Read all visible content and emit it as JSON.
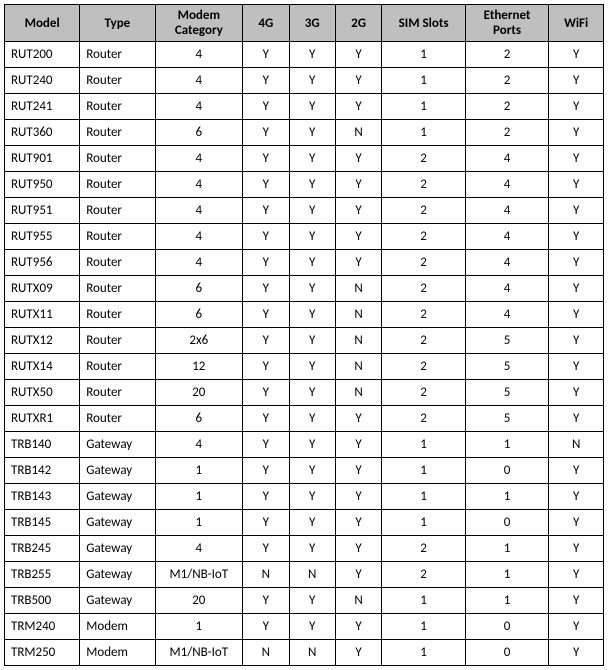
{
  "chart_data": {
    "type": "table",
    "columns": [
      "Model",
      "Type",
      "Modem Category",
      "4G",
      "3G",
      "2G",
      "SIM Slots",
      "Ethernet Ports",
      "WiFi"
    ],
    "rows": [
      [
        "RUT200",
        "Router",
        "4",
        "Y",
        "Y",
        "Y",
        "1",
        "2",
        "Y"
      ],
      [
        "RUT240",
        "Router",
        "4",
        "Y",
        "Y",
        "Y",
        "1",
        "2",
        "Y"
      ],
      [
        "RUT241",
        "Router",
        "4",
        "Y",
        "Y",
        "Y",
        "1",
        "2",
        "Y"
      ],
      [
        "RUT360",
        "Router",
        "6",
        "Y",
        "Y",
        "N",
        "1",
        "2",
        "Y"
      ],
      [
        "RUT901",
        "Router",
        "4",
        "Y",
        "Y",
        "Y",
        "2",
        "4",
        "Y"
      ],
      [
        "RUT950",
        "Router",
        "4",
        "Y",
        "Y",
        "Y",
        "2",
        "4",
        "Y"
      ],
      [
        "RUT951",
        "Router",
        "4",
        "Y",
        "Y",
        "Y",
        "2",
        "4",
        "Y"
      ],
      [
        "RUT955",
        "Router",
        "4",
        "Y",
        "Y",
        "Y",
        "2",
        "4",
        "Y"
      ],
      [
        "RUT956",
        "Router",
        "4",
        "Y",
        "Y",
        "Y",
        "2",
        "4",
        "Y"
      ],
      [
        "RUTX09",
        "Router",
        "6",
        "Y",
        "Y",
        "N",
        "2",
        "4",
        "Y"
      ],
      [
        "RUTX11",
        "Router",
        "6",
        "Y",
        "Y",
        "N",
        "2",
        "4",
        "Y"
      ],
      [
        "RUTX12",
        "Router",
        "2x6",
        "Y",
        "Y",
        "N",
        "2",
        "5",
        "Y"
      ],
      [
        "RUTX14",
        "Router",
        "12",
        "Y",
        "Y",
        "N",
        "2",
        "5",
        "Y"
      ],
      [
        "RUTX50",
        "Router",
        "20",
        "Y",
        "Y",
        "N",
        "2",
        "5",
        "Y"
      ],
      [
        "RUTXR1",
        "Router",
        "6",
        "Y",
        "Y",
        "Y",
        "2",
        "5",
        "Y"
      ],
      [
        "TRB140",
        "Gateway",
        "4",
        "Y",
        "Y",
        "Y",
        "1",
        "1",
        "N"
      ],
      [
        "TRB142",
        "Gateway",
        "1",
        "Y",
        "Y",
        "Y",
        "1",
        "0",
        "Y"
      ],
      [
        "TRB143",
        "Gateway",
        "1",
        "Y",
        "Y",
        "Y",
        "1",
        "1",
        "Y"
      ],
      [
        "TRB145",
        "Gateway",
        "1",
        "Y",
        "Y",
        "Y",
        "1",
        "0",
        "Y"
      ],
      [
        "TRB245",
        "Gateway",
        "4",
        "Y",
        "Y",
        "Y",
        "2",
        "1",
        "Y"
      ],
      [
        "TRB255",
        "Gateway",
        "M1/NB-IoT",
        "N",
        "N",
        "Y",
        "2",
        "1",
        "Y"
      ],
      [
        "TRB500",
        "Gateway",
        "20",
        "Y",
        "Y",
        "N",
        "1",
        "1",
        "Y"
      ],
      [
        "TRM240",
        "Modem",
        "1",
        "Y",
        "Y",
        "Y",
        "1",
        "0",
        "Y"
      ],
      [
        "TRM250",
        "Modem",
        "M1/NB-IoT",
        "N",
        "N",
        "Y",
        "1",
        "0",
        "Y"
      ]
    ]
  }
}
